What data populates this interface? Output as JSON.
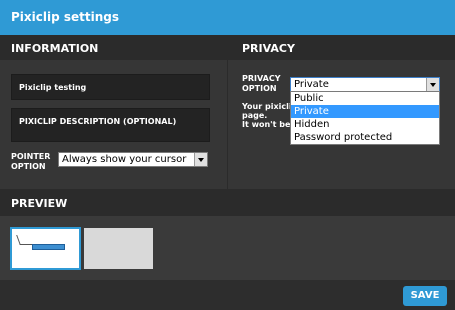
{
  "window": {
    "title": "Pixiclip settings"
  },
  "information": {
    "header": "INFORMATION",
    "name_value": "Pixiclip testing",
    "description_placeholder": "PIXICLIP DESCRIPTION (OPTIONAL)",
    "pointer_label_line1": "POINTER",
    "pointer_label_line2": "OPTION",
    "pointer_selected": "Always show your cursor"
  },
  "privacy": {
    "header": "PRIVACY",
    "label_line1": "PRIVACY",
    "label_line2": "OPTION",
    "selected": "Private",
    "help_line1": "Your pixicli",
    "help_line2": "page.",
    "help_line3": "It won't be",
    "options": [
      "Public",
      "Private",
      "Hidden",
      "Password protected"
    ],
    "highlighted_option": "Private"
  },
  "preview": {
    "header": "PREVIEW"
  },
  "footer": {
    "save_label": "SAVE"
  },
  "colors": {
    "accent": "#2f9ad5",
    "panel": "#363636",
    "header_dark": "#2b2b2b",
    "highlight": "#3399ff"
  }
}
